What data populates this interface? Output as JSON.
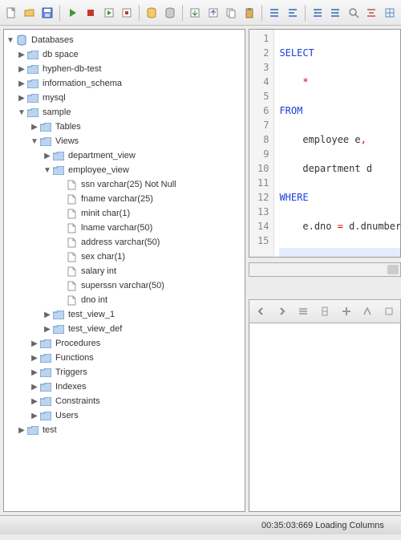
{
  "toolbar": {
    "items": [
      "new",
      "open",
      "save",
      "sep",
      "run",
      "stop",
      "copy-run",
      "copy-stop",
      "sep",
      "db1",
      "db2",
      "sep",
      "export",
      "import",
      "copy",
      "paste",
      "sep",
      "align1",
      "align2",
      "sep",
      "indent-left",
      "indent-right",
      "find",
      "format",
      "grid"
    ]
  },
  "tree": {
    "root": {
      "label": "Databases"
    },
    "db_space": "db space",
    "hyphen": "hyphen-db-test",
    "info_schema": "information_schema",
    "mysql": "mysql",
    "sample": "sample",
    "tables": "Tables",
    "views": "Views",
    "dept_view": "department_view",
    "emp_view": "employee_view",
    "cols": [
      "ssn varchar(25) Not Null",
      "fname varchar(25)",
      "minit char(1)",
      "lname varchar(50)",
      "address varchar(50)",
      "sex char(1)",
      "salary int",
      "superssn varchar(50)",
      "dno int"
    ],
    "test_view_1": "test_view_1",
    "test_view_def": "test_view_def",
    "procedures": "Procedures",
    "functions": "Functions",
    "triggers": "Triggers",
    "indexes": "Indexes",
    "constraints": "Constraints",
    "users": "Users",
    "test": "test"
  },
  "sql": {
    "l1_kw": "SELECT",
    "l2": "    *",
    "l3_kw": "FROM",
    "l4": "    employee e",
    "l5": "    department d",
    "l6_kw": "WHERE",
    "l7a": "    e",
    "l7b": "dno ",
    "l7c": " d",
    "l7d": "dnumber",
    "comma": ",",
    "dot": ".",
    "eq": "="
  },
  "line_count": 15,
  "status": {
    "text": "00:35:03:669 Loading Columns"
  }
}
